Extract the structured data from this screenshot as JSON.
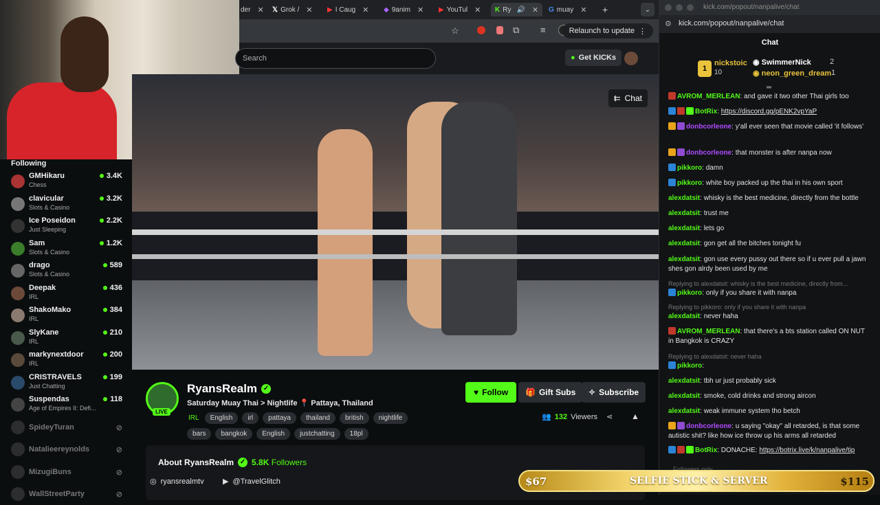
{
  "browser": {
    "tabs": [
      {
        "label": "der",
        "icon": "page-icon"
      },
      {
        "label": "Grok /",
        "icon": "x-logo-icon"
      },
      {
        "label": "I Caug",
        "icon": "youtube-icon"
      },
      {
        "label": "9anim",
        "icon": "anime-icon"
      },
      {
        "label": "YouTul",
        "icon": "youtube-icon"
      },
      {
        "label": "Ry",
        "icon": "kick-icon",
        "active": true
      },
      {
        "label": "muay",
        "icon": "google-icon"
      }
    ],
    "relaunch_label": "Relaunch to update"
  },
  "kick": {
    "search_placeholder": "Search",
    "get_kicks_label": "Get KICKs",
    "chat_button_label": "Chat"
  },
  "sidebar": {
    "title": "Following",
    "items": [
      {
        "name": "GMHikaru",
        "category": "Chess",
        "viewers": "3.4K",
        "live": true,
        "color": "#a33"
      },
      {
        "name": "clavicular",
        "category": "Slots & Casino",
        "viewers": "3.2K",
        "live": true,
        "color": "#777"
      },
      {
        "name": "Ice Poseidon",
        "category": "Just Sleeping",
        "viewers": "2.2K",
        "live": true,
        "color": "#333"
      },
      {
        "name": "Sam",
        "category": "Slots & Casino",
        "viewers": "1.2K",
        "live": true,
        "color": "#3a7d2a"
      },
      {
        "name": "drago",
        "category": "Slots & Casino",
        "viewers": "589",
        "live": true,
        "color": "#666"
      },
      {
        "name": "Deepak",
        "category": "IRL",
        "viewers": "436",
        "live": true,
        "color": "#6b4a3a"
      },
      {
        "name": "ShakoMako",
        "category": "IRL",
        "viewers": "384",
        "live": true,
        "color": "#8a7a70"
      },
      {
        "name": "SlyKane",
        "category": "IRL",
        "viewers": "210",
        "live": true,
        "color": "#4a5a4a"
      },
      {
        "name": "markynextdoor",
        "category": "IRL",
        "viewers": "200",
        "live": true,
        "color": "#5a4a3a"
      },
      {
        "name": "CRISTRAVELS",
        "category": "Just Chatting",
        "viewers": "199",
        "live": true,
        "color": "#2a4a6a"
      },
      {
        "name": "Suspendas",
        "category": "Age of Empires II: Defi...",
        "viewers": "118",
        "live": true,
        "color": "#444"
      },
      {
        "name": "SpideyTuran",
        "category": "",
        "viewers": "",
        "live": false,
        "color": "#555"
      },
      {
        "name": "Natalieereynolds",
        "category": "",
        "viewers": "",
        "live": false,
        "color": "#555"
      },
      {
        "name": "MizugiBuns",
        "category": "",
        "viewers": "",
        "live": false,
        "color": "#555"
      },
      {
        "name": "WallStreetParty",
        "category": "",
        "viewers": "",
        "live": false,
        "color": "#555"
      }
    ]
  },
  "stream": {
    "channel": "RyansRealm",
    "live_badge": "LIVE",
    "title": "Saturday Muay Thai > Nightlife 📍 Pattaya, Thailand",
    "tags": [
      {
        "label": "IRL",
        "lang": true
      },
      {
        "label": "English"
      },
      {
        "label": "irl"
      },
      {
        "label": "pattaya"
      },
      {
        "label": "thailand"
      },
      {
        "label": "british"
      },
      {
        "label": "nightlife"
      },
      {
        "label": "bars"
      },
      {
        "label": "bangkok"
      },
      {
        "label": "English"
      },
      {
        "label": "justchatting"
      },
      {
        "label": "18pl"
      }
    ],
    "follow_label": "Follow",
    "gift_label": "Gift Subs",
    "subscribe_label": "Subscribe",
    "viewers_count": "132",
    "viewers_label": "Viewers",
    "about_label": "About RyansRealm",
    "followers_count": "5.8K",
    "followers_label": "Followers",
    "socials": [
      {
        "icon": "instagram-icon",
        "handle": "ryansrealmtv"
      },
      {
        "icon": "youtube-icon",
        "handle": "@TravelGlitch"
      }
    ]
  },
  "chat": {
    "window_title": "kick.com/popout/nanpalive/chat",
    "url": "kick.com/popout/nanpalive/chat",
    "header": "Chat",
    "leaderboard": [
      {
        "rank": "1",
        "name": "nickstoic",
        "count": "10",
        "color": "#e9c33b"
      },
      {
        "rank": "",
        "name": "SwimmerNick",
        "count": "2",
        "color": "#ffffff"
      },
      {
        "rank": "",
        "name": "neon_green_dream",
        "count": "1",
        "color": "#e9c33b"
      }
    ],
    "messages": [
      {
        "user": "AVROM_MERLEAN",
        "color": "#53fc18",
        "badges": [
          "#c0392b"
        ],
        "text": "and gave it two other Thai girls too"
      },
      {
        "user": "BotRix",
        "color": "#53fc18",
        "badges": [
          "#2b84d6",
          "#c0392b",
          "#53fc18"
        ],
        "text": "",
        "link": "https://discord.gg/pENK2vpYaP"
      },
      {
        "user": "donbcorleone",
        "color": "#b04cff",
        "badges": [
          "#e9a41c",
          "#8f4bd1"
        ],
        "text": "y'all ever seen that movie called 'it follows'"
      },
      {
        "user": "donbcorleone",
        "color": "#b04cff",
        "badges": [
          "#e9a41c",
          "#8f4bd1"
        ],
        "text": "that monster is after nanpa now"
      },
      {
        "user": "pikkoro",
        "color": "#53fc18",
        "badges": [
          "#2b84d6"
        ],
        "text": "damn"
      },
      {
        "user": "pikkoro",
        "color": "#53fc18",
        "badges": [
          "#2b84d6"
        ],
        "text": "white boy packed up the thai in his own sport"
      },
      {
        "user": "alexdatsit",
        "color": "#53fc18",
        "badges": [],
        "text": "whisky is the best medicine, directly from the bottle"
      },
      {
        "user": "alexdatsit",
        "color": "#53fc18",
        "badges": [],
        "text": "trust me"
      },
      {
        "user": "alexdatsit",
        "color": "#53fc18",
        "badges": [],
        "text": "lets go"
      },
      {
        "user": "alexdatsit",
        "color": "#53fc18",
        "badges": [],
        "text": "gon get all the bitches tonight fu"
      },
      {
        "user": "alexdatsit",
        "color": "#53fc18",
        "badges": [],
        "text": "gon use every pussy out there so if u ever pull a jawn shes gon alrdy been used by me"
      },
      {
        "reply": "Replying to alexdatsit: whisky is the best medicine, directly from..."
      },
      {
        "user": "pikkoro",
        "color": "#53fc18",
        "badges": [
          "#2b84d6"
        ],
        "text": "only if you share it with nanpa"
      },
      {
        "reply": "Replying to pikkoro: only if you share it with nanpa"
      },
      {
        "user": "alexdatsit",
        "color": "#53fc18",
        "badges": [],
        "text": "never haha"
      },
      {
        "user": "AVROM_MERLEAN",
        "color": "#53fc18",
        "badges": [
          "#c0392b"
        ],
        "text": "that there's a bts station called ON NUT in Bangkok is CRAZY"
      },
      {
        "reply": "Replying to alexdatsit: never haha"
      },
      {
        "user": "pikkoro",
        "color": "#53fc18",
        "badges": [
          "#2b84d6"
        ],
        "text": ""
      },
      {
        "user": "alexdatsit",
        "color": "#53fc18",
        "badges": [],
        "text": "tbh ur just probably sick"
      },
      {
        "user": "alexdatsit",
        "color": "#53fc18",
        "badges": [],
        "text": "smoke, cold drinks and strong aircon"
      },
      {
        "user": "alexdatsit",
        "color": "#53fc18",
        "badges": [],
        "text": "weak immune system tho betch"
      },
      {
        "user": "donbcorleone",
        "color": "#b04cff",
        "badges": [
          "#e9a41c",
          "#8f4bd1"
        ],
        "text": "u saying \"okay\" all retarded, is that some autistic shit? like how ice throw up his arms all retarded"
      },
      {
        "user": "BotRix",
        "color": "#53fc18",
        "badges": [
          "#2b84d6",
          "#c0392b",
          "#53fc18"
        ],
        "text": "DONACHE:",
        "link": "https://botrix.live/k/nanpalive/tip"
      }
    ],
    "footer": "Followers only"
  },
  "banner": {
    "left_price": "$67",
    "middle_text": "SELFIE STICK & SERVER",
    "right_price": "$115"
  }
}
